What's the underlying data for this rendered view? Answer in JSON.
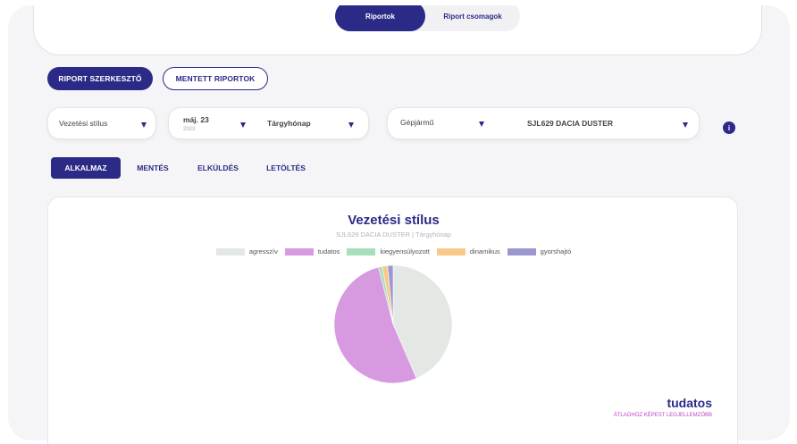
{
  "tabs_top": {
    "reports": "Riportok",
    "report_packages": "Riport csomagok"
  },
  "mode": {
    "editor": "RIPORT SZERKESZTŐ",
    "saved": "MENTETT RIPORTOK"
  },
  "filters": {
    "report_type": "Vezetési stílus",
    "date_main": "máj. 23",
    "date_year": "2023",
    "period": "Tárgyhónap",
    "entity_type": "Gépjármű",
    "vehicle": "SJL629 DACIA DUSTER",
    "info_icon": "i"
  },
  "actions": {
    "apply": "ALKALMAZ",
    "save": "MENTÉS",
    "send": "ELKÜLDÉS",
    "download": "LETÖLTÉS"
  },
  "chart_data": {
    "type": "pie",
    "title": "Vezetési stílus",
    "subtitle": "SJL629 DACIA DUSTER | Tárgyhónap",
    "legend_position": "top",
    "slices": [
      {
        "label": "agresszív",
        "value": 43.5,
        "color": "#e3e8e4"
      },
      {
        "label": "tudatos",
        "value": 52.5,
        "color": "#d79ae0"
      },
      {
        "label": "kiegyensúlyozott",
        "value": 1.0,
        "color": "#a7dfbc"
      },
      {
        "label": "dinamikus",
        "value": 1.5,
        "color": "#f9c98c"
      },
      {
        "label": "gyorshajtó",
        "value": 1.5,
        "color": "#9c98cf"
      }
    ]
  },
  "highlight": {
    "value": "tudatos",
    "note": "ÁTLAGHOZ KÉPEST LEGJELLEMZŐBB"
  },
  "colors": {
    "brand": "#2b2a87",
    "accent": "#c042c8"
  }
}
